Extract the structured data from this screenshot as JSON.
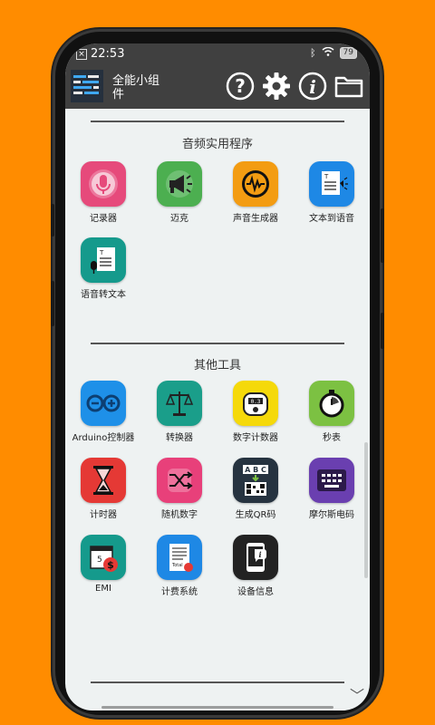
{
  "status": {
    "time": "22:53",
    "battery": "79"
  },
  "app": {
    "title": "全能小组件"
  },
  "sections": [
    {
      "title": "音频实用程序",
      "items": [
        {
          "label": "记录器",
          "color": "#e64a7b",
          "icon": "microphone-icon"
        },
        {
          "label": "迈克",
          "color": "#4caf50",
          "icon": "megaphone-icon"
        },
        {
          "label": "声音生成器",
          "color": "#f39c12",
          "icon": "sound-wave-icon"
        },
        {
          "label": "文本到语音",
          "color": "#1e88e5",
          "icon": "text-to-speech-icon"
        },
        {
          "label": "语音转文本",
          "color": "#159a8c",
          "icon": "speech-to-text-icon"
        }
      ]
    },
    {
      "title": "其他工具",
      "items": [
        {
          "label": "Arduino控制器",
          "color": "#1e90e8",
          "icon": "arduino-icon"
        },
        {
          "label": "转换器",
          "color": "#1a9e8a",
          "icon": "scale-icon"
        },
        {
          "label": "数字计数器",
          "color": "#f5d90a",
          "icon": "counter-icon"
        },
        {
          "label": "秒表",
          "color": "#7cc142",
          "icon": "stopwatch-icon"
        },
        {
          "label": "计时器",
          "color": "#e53935",
          "icon": "hourglass-icon"
        },
        {
          "label": "随机数字",
          "color": "#e8407a",
          "icon": "shuffle-icon"
        },
        {
          "label": "生成QR码",
          "color": "#263340",
          "icon": "qr-code-icon"
        },
        {
          "label": "摩尔斯电码",
          "color": "#6a3fb0",
          "icon": "morse-keyboard-icon"
        },
        {
          "label": "EMI",
          "color": "#159a8c",
          "icon": "emi-calendar-icon"
        },
        {
          "label": "计费系统",
          "color": "#1e88e5",
          "icon": "billing-receipt-icon"
        },
        {
          "label": "设备信息",
          "color": "#222222",
          "icon": "device-info-icon"
        }
      ]
    }
  ]
}
